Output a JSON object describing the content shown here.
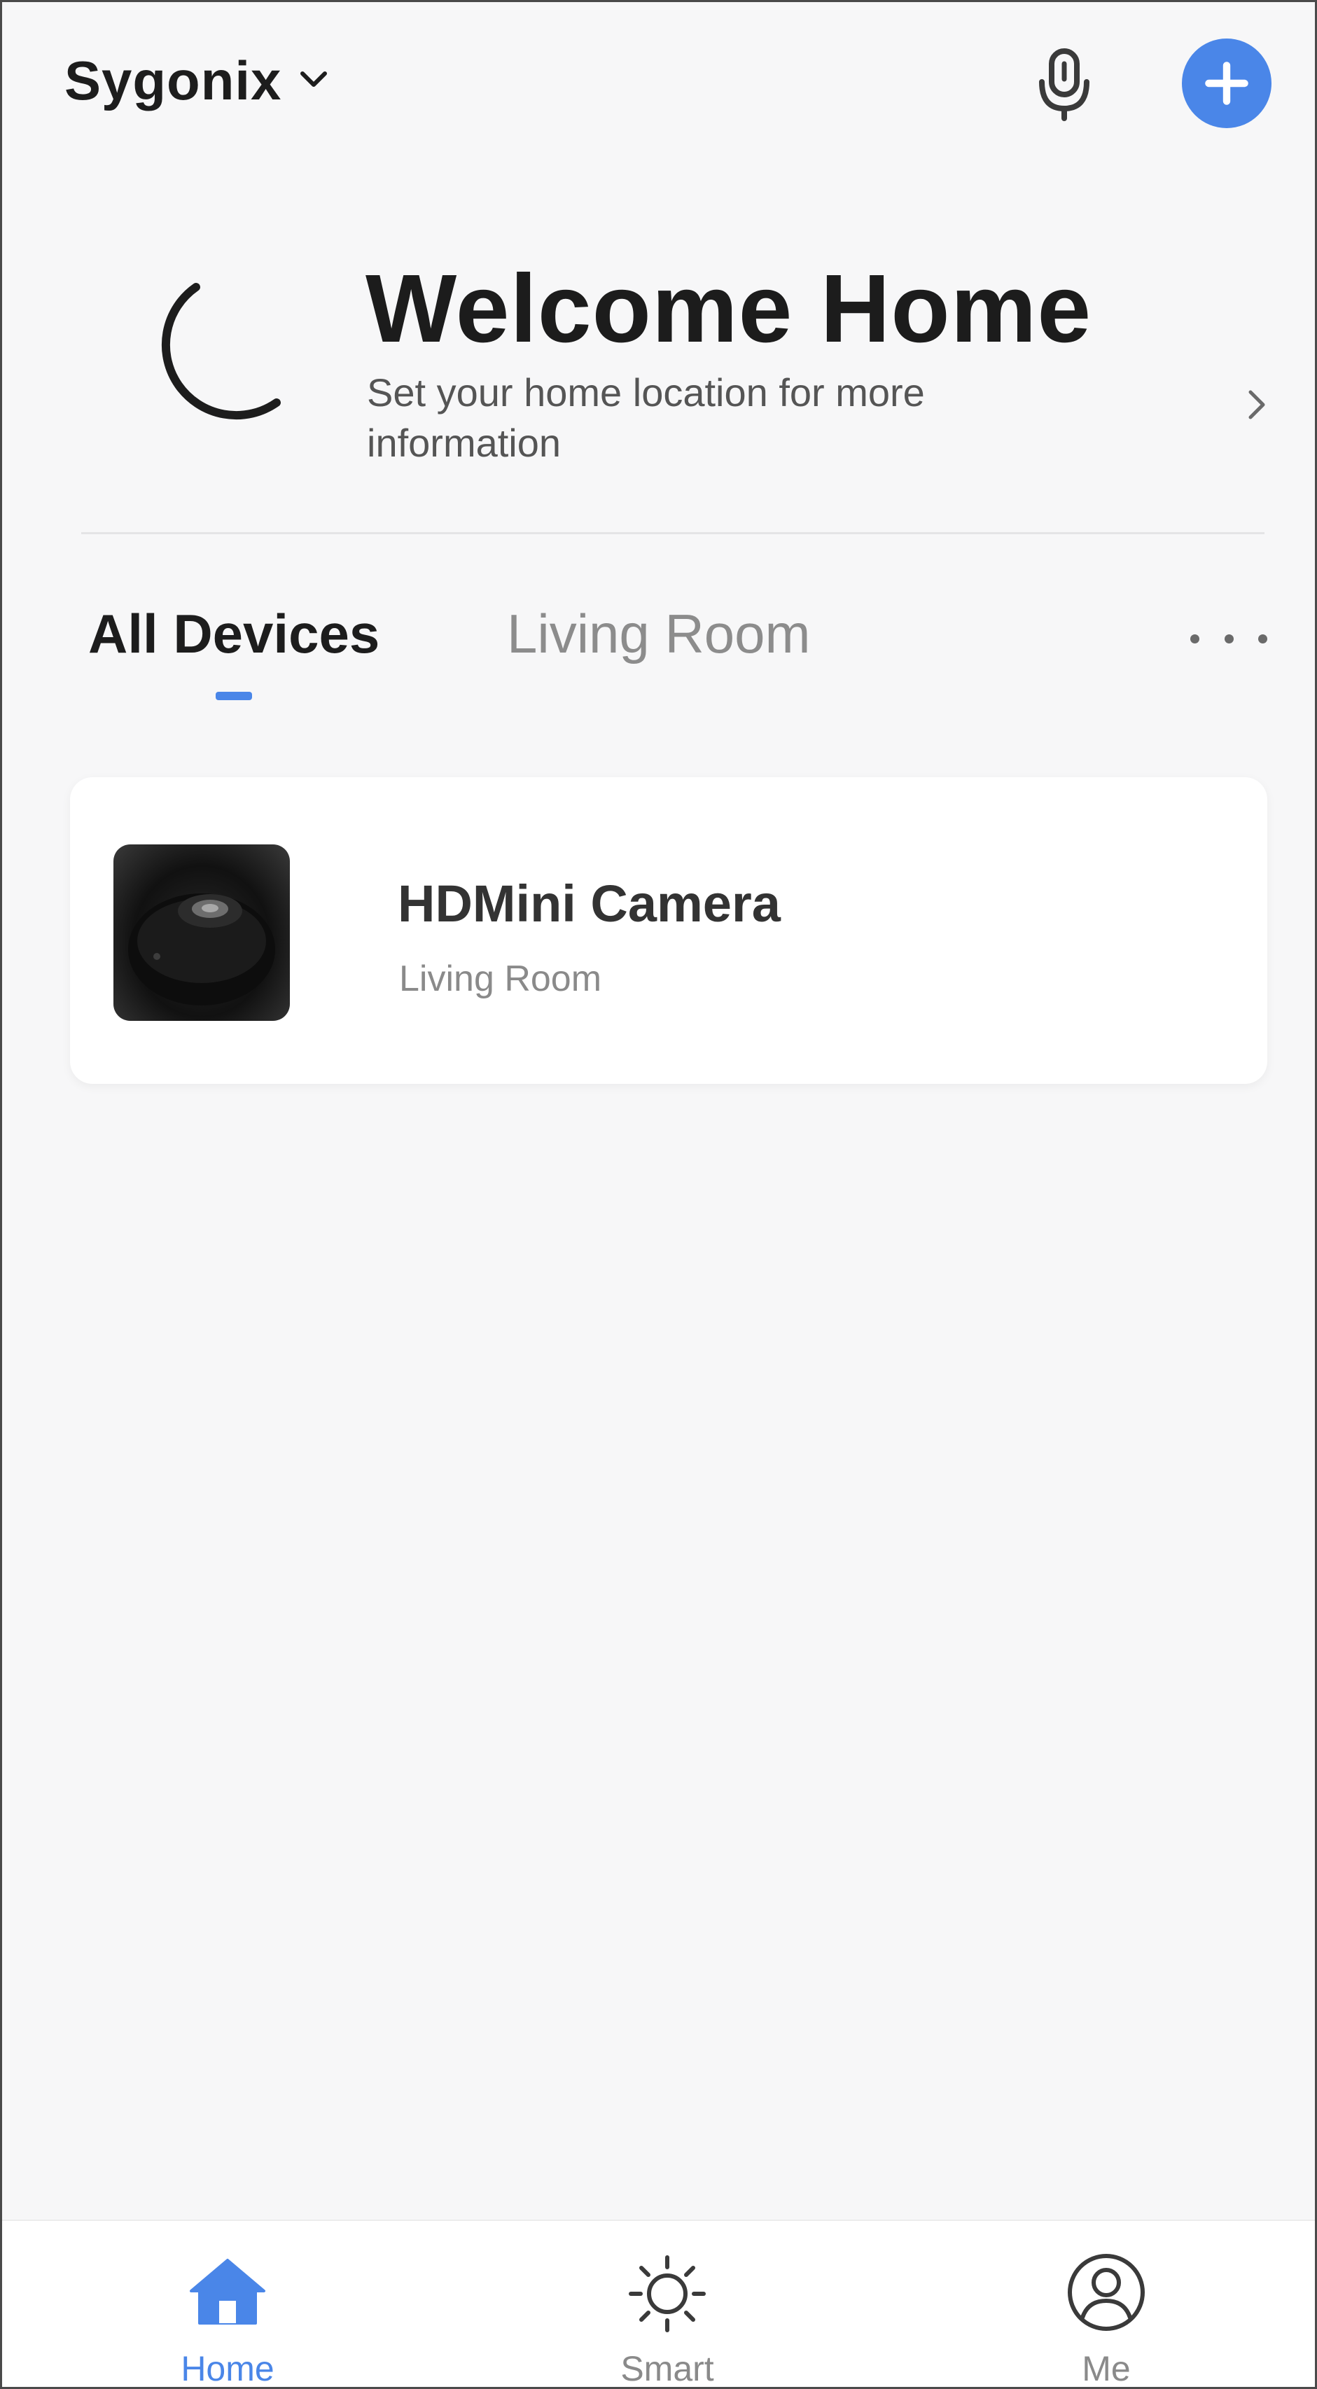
{
  "header": {
    "home_name": "Sygonix",
    "icons": {
      "dropdown": "chevron-down-icon",
      "voice": "microphone-icon",
      "add": "plus-icon"
    }
  },
  "welcome": {
    "title": "Welcome Home",
    "subtitle": "Set your home location for more information",
    "icon": "moon-icon"
  },
  "tabs": {
    "items": [
      {
        "label": "All Devices",
        "active": true
      },
      {
        "label": "Living Room",
        "active": false
      }
    ],
    "more_icon": "more-horizontal-icon"
  },
  "devices": [
    {
      "name": "HDMini Camera",
      "room": "Living Room"
    }
  ],
  "bottom_nav": {
    "items": [
      {
        "label": "Home",
        "icon": "home-icon",
        "active": true
      },
      {
        "label": "Smart",
        "icon": "sun-icon",
        "active": false
      },
      {
        "label": "Me",
        "icon": "profile-icon",
        "active": false
      }
    ]
  },
  "colors": {
    "accent": "#4a86e8",
    "background": "#f7f7f8",
    "card": "#ffffff",
    "text_primary": "#1d1d1d",
    "text_secondary": "#8a8a8a"
  }
}
